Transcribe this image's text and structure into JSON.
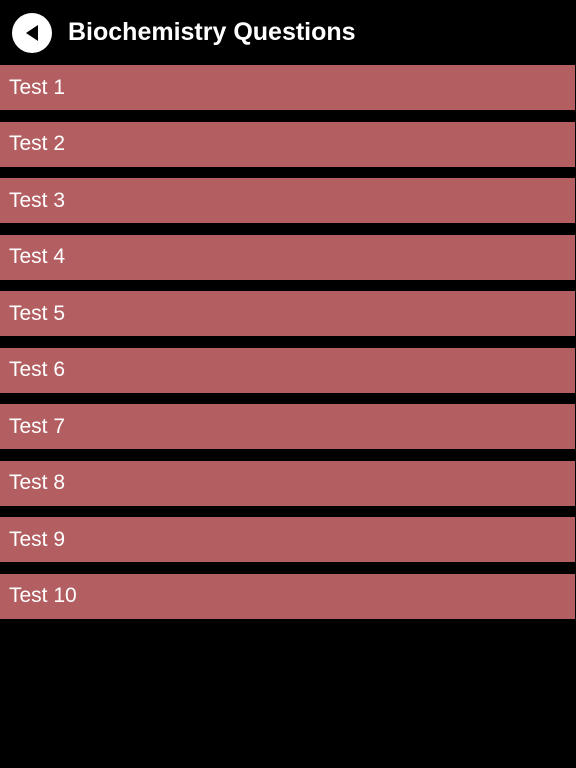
{
  "header": {
    "title": "Biochemistry Questions",
    "back_icon": "back-arrow-icon"
  },
  "colors": {
    "background": "#000000",
    "item_background": "#b35f62",
    "text": "#ffffff",
    "back_button_bg": "#ffffff",
    "back_icon": "#000000"
  },
  "tests": [
    {
      "label": "Test 1"
    },
    {
      "label": "Test 2"
    },
    {
      "label": "Test 3"
    },
    {
      "label": "Test 4"
    },
    {
      "label": "Test 5"
    },
    {
      "label": "Test 6"
    },
    {
      "label": "Test 7"
    },
    {
      "label": "Test 8"
    },
    {
      "label": "Test 9"
    },
    {
      "label": "Test 10"
    }
  ]
}
